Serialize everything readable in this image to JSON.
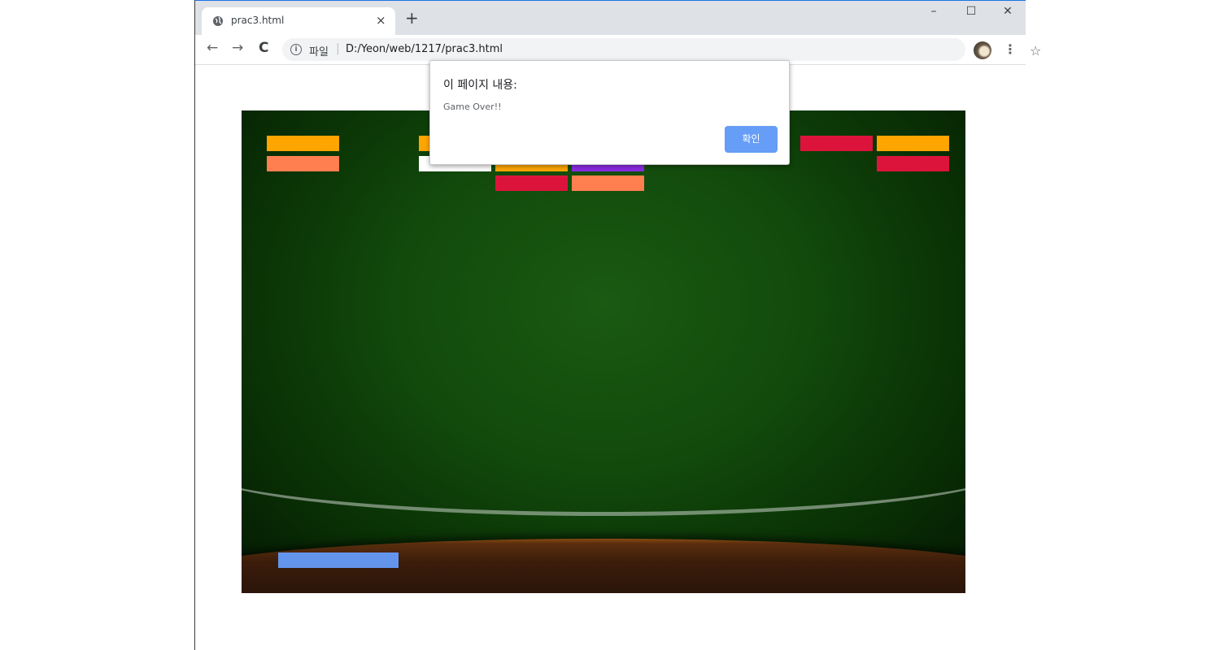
{
  "browser": {
    "tab": {
      "title": "prac3.html",
      "close": "×",
      "new_tab": "+"
    },
    "window_controls": {
      "minimize": "–",
      "maximize": "☐",
      "close": "✕"
    },
    "nav": {
      "back": "←",
      "forward": "→",
      "reload": "C"
    },
    "address": {
      "info_icon": "i",
      "scheme_label": "파일",
      "separator": "|",
      "url": "D:/Yeon/web/1217/prac3.html",
      "bookmark_icon": "☆",
      "menu_icon": "⋮"
    }
  },
  "alert": {
    "title": "이 페이지 내용:",
    "message": "Game Over!!",
    "ok_label": "확인"
  },
  "game": {
    "colors": {
      "orange": "#ffa500",
      "coral": "#ff7f50",
      "white": "#ffffff",
      "crimson": "#dc143c",
      "purple": "#8a2be2",
      "paddle": "#6495ed"
    },
    "bricks": [
      {
        "row": 0,
        "col": 0,
        "color": "orange"
      },
      {
        "row": 1,
        "col": 0,
        "color": "coral"
      },
      {
        "row": 0,
        "col": 2,
        "color": "orange"
      },
      {
        "row": 1,
        "col": 2,
        "color": "white"
      },
      {
        "row": 1,
        "col": 3,
        "color": "orange"
      },
      {
        "row": 2,
        "col": 3,
        "color": "crimson"
      },
      {
        "row": 1,
        "col": 4,
        "color": "purple"
      },
      {
        "row": 2,
        "col": 4,
        "color": "coral"
      },
      {
        "row": 0,
        "col": 7,
        "color": "crimson"
      },
      {
        "row": 0,
        "col": 8,
        "color": "orange"
      },
      {
        "row": 1,
        "col": 8,
        "color": "crimson"
      }
    ]
  }
}
